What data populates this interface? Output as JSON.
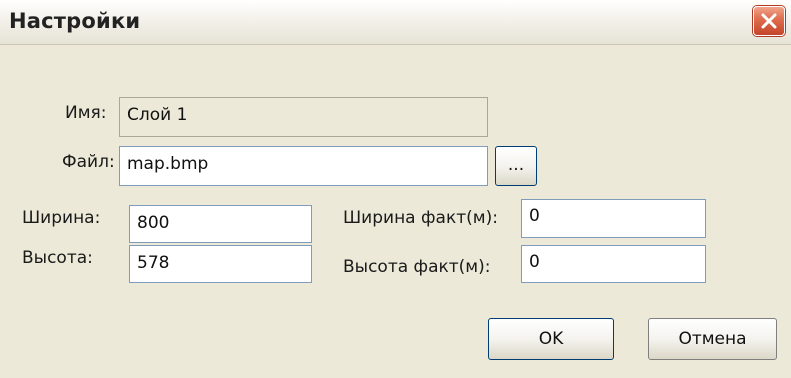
{
  "window": {
    "title": "Настройки",
    "close_icon": "close-icon"
  },
  "form": {
    "name_label": "Имя:",
    "name_value": "Слой 1",
    "file_label": "Файл:",
    "file_value": "map.bmp",
    "browse_label": "...",
    "width_label": "Ширина:",
    "width_value": "800",
    "height_label": "Высота:",
    "height_value": "578",
    "width_fact_label": "Ширина факт(м):",
    "width_fact_value": "0",
    "height_fact_label": "Высота факт(м):",
    "height_fact_value": "0"
  },
  "buttons": {
    "ok_label": "OK",
    "cancel_label": "Отмена"
  },
  "colors": {
    "dialog_background": "#ece9d8",
    "close_button": "#d9583b",
    "field_border": "#7f9db9",
    "button_border": "#003c74"
  }
}
